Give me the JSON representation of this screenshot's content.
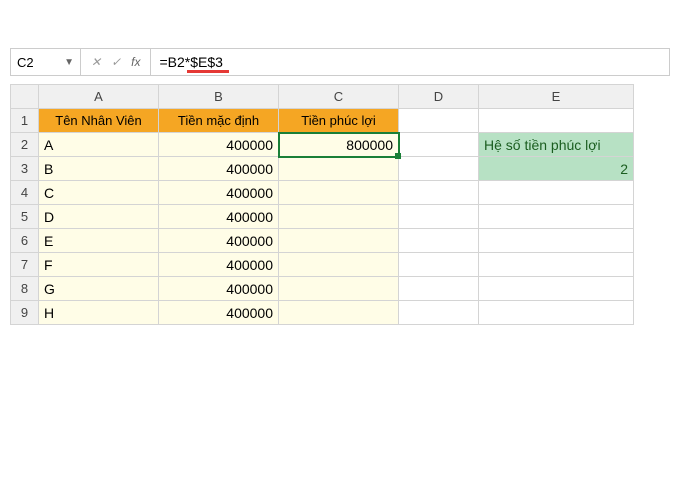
{
  "formula_bar": {
    "name_box": "C2",
    "cancel": "✕",
    "confirm": "✓",
    "fx": "fx",
    "formula": "=B2*$E$3"
  },
  "columns": [
    "A",
    "B",
    "C",
    "D",
    "E"
  ],
  "rows": [
    "1",
    "2",
    "3",
    "4",
    "5",
    "6",
    "7",
    "8",
    "9"
  ],
  "headers": {
    "a": "Tên Nhân Viên",
    "b": "Tiền mặc định",
    "c": "Tiền phúc lợi"
  },
  "data": [
    {
      "name": "A",
      "base": "400000",
      "welfare": "800000"
    },
    {
      "name": "B",
      "base": "400000",
      "welfare": ""
    },
    {
      "name": "C",
      "base": "400000",
      "welfare": ""
    },
    {
      "name": "D",
      "base": "400000",
      "welfare": ""
    },
    {
      "name": "E",
      "base": "400000",
      "welfare": ""
    },
    {
      "name": "F",
      "base": "400000",
      "welfare": ""
    },
    {
      "name": "G",
      "base": "400000",
      "welfare": ""
    },
    {
      "name": "H",
      "base": "400000",
      "welfare": ""
    }
  ],
  "side": {
    "label": "Hệ số tiền phúc lợi",
    "value": "2"
  }
}
